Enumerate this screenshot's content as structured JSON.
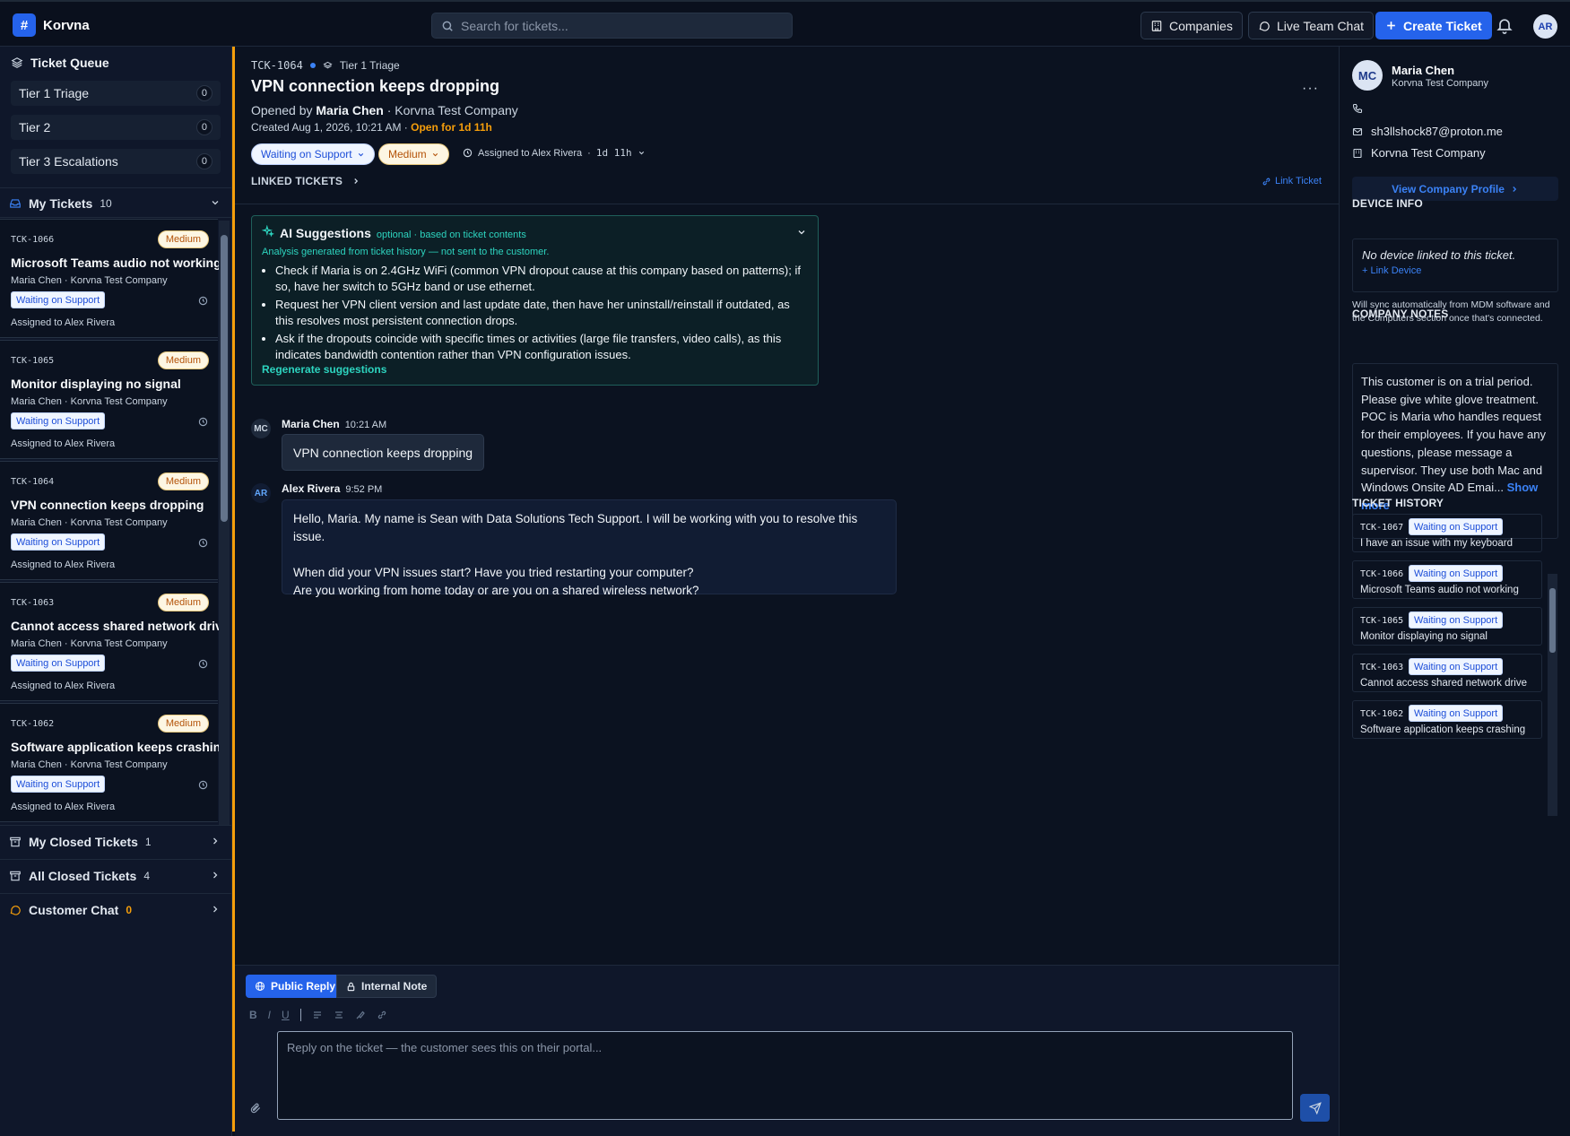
{
  "app": {
    "name": "Korvna",
    "logo_glyph": "#"
  },
  "search": {
    "placeholder": "Search for tickets..."
  },
  "topbar": {
    "companies": "Companies",
    "live_chat": "Live Team Chat",
    "create": "Create Ticket",
    "user_initials": "AR"
  },
  "sidebar": {
    "queue_title": "Ticket Queue",
    "queues": [
      {
        "label": "Tier 1 Triage",
        "count": "0"
      },
      {
        "label": "Tier 2",
        "count": "0"
      },
      {
        "label": "Tier 3 Escalations",
        "count": "0"
      }
    ],
    "my_tickets": {
      "label": "My Tickets",
      "count": "10"
    },
    "tickets": [
      {
        "id": "TCK-1066",
        "priority": "Medium",
        "title": "Microsoft Teams audio not working",
        "sub": "Maria Chen · Korvna Test Company",
        "status": "Waiting on Support",
        "assigned": "Assigned to Alex Rivera"
      },
      {
        "id": "TCK-1065",
        "priority": "Medium",
        "title": "Monitor displaying no signal",
        "sub": "Maria Chen · Korvna Test Company",
        "status": "Waiting on Support",
        "assigned": "Assigned to Alex Rivera"
      },
      {
        "id": "TCK-1064",
        "priority": "Medium",
        "title": "VPN connection keeps dropping",
        "sub": "Maria Chen · Korvna Test Company",
        "status": "Waiting on Support",
        "assigned": "Assigned to Alex Rivera"
      },
      {
        "id": "TCK-1063",
        "priority": "Medium",
        "title": "Cannot access shared network drive",
        "sub": "Maria Chen · Korvna Test Company",
        "status": "Waiting on Support",
        "assigned": "Assigned to Alex Rivera"
      },
      {
        "id": "TCK-1062",
        "priority": "Medium",
        "title": "Software application keeps crashing",
        "sub": "Maria Chen · Korvna Test Company",
        "status": "Waiting on Support",
        "assigned": "Assigned to Alex Rivera"
      }
    ],
    "my_closed": {
      "label": "My Closed Tickets",
      "count": "1"
    },
    "all_closed": {
      "label": "All Closed Tickets",
      "count": "4"
    },
    "customer_chat": {
      "label": "Customer Chat",
      "count": "0"
    }
  },
  "ticket": {
    "id": "TCK-1064",
    "queue": "Tier 1 Triage",
    "title": "VPN connection keeps dropping",
    "opened_prefix": "Opened by",
    "opened_by": "Maria Chen",
    "opened_suffix": "· Korvna Test Company",
    "created": "Created Aug 1, 2026, 10:21 AM ·",
    "open_for": "Open for 1d 11h",
    "status": "Waiting on Support",
    "priority": "Medium",
    "assigned": "Assigned to Alex Rivera",
    "sep": "·",
    "age": "1d 11h",
    "more": "···",
    "linked_label": "LINKED TICKETS",
    "link_action": "Link Ticket"
  },
  "ai": {
    "title": "AI Suggestions",
    "subtitle": "optional · based on ticket contents",
    "note": "Analysis generated from ticket history — not sent to the customer.",
    "suggestions": [
      "Check if Maria is on 2.4GHz WiFi (common VPN dropout cause at this company based on patterns); if so, have her switch to 5GHz band or use ethernet.",
      "Request her VPN client version and last update date, then have her uninstall/reinstall if outdated, as this resolves most persistent connection drops.",
      "Ask if the dropouts coincide with specific times or activities (large file transfers, video calls), as this indicates bandwidth contention rather than VPN configuration issues."
    ],
    "regenerate": "Regenerate suggestions"
  },
  "messages": [
    {
      "initials": "MC",
      "author": "Maria Chen",
      "time": "10:21 AM",
      "body": "VPN connection keeps dropping"
    },
    {
      "initials": "AR",
      "author": "Alex Rivera",
      "time": "9:52 PM",
      "lines": [
        "Hello, Maria. My name is Sean with Data Solutions Tech Support. I will be working with you to resolve this issue.",
        "When did your VPN issues start? Have you tried restarting your computer?",
        "Are you working from home today or are you on a shared wireless network?"
      ]
    }
  ],
  "composer": {
    "public_reply": "Public Reply",
    "internal_note": "Internal Note",
    "toolbar": [
      "B",
      "I",
      "U"
    ],
    "placeholder": "Reply on the ticket — the customer sees this on their portal..."
  },
  "contact": {
    "initials": "MC",
    "name": "Maria Chen",
    "company": "Korvna Test Company",
    "phone": "",
    "email": "sh3llshock87@proton.me",
    "company_line": "Korvna Test Company",
    "view_profile": "View Company Profile"
  },
  "device": {
    "title": "DEVICE INFO",
    "none": "No device linked to this ticket.",
    "link": "+ Link Device",
    "sync_note": "Will sync automatically from MDM software and the Computers section once that's connected."
  },
  "notes": {
    "title": "COMPANY NOTES",
    "text": "This customer is on a trial period. Please give white glove treatment. POC is Maria who handles request for their employees. If you have any questions, please message a supervisor. They use both Mac and Windows Onsite AD Emai...",
    "more": "Show more"
  },
  "history": {
    "title": "TICKET HISTORY",
    "items": [
      {
        "id": "TCK-1067",
        "status": "Waiting on Support",
        "title": "I have an issue with my keyboard"
      },
      {
        "id": "TCK-1066",
        "status": "Waiting on Support",
        "title": "Microsoft Teams audio not working"
      },
      {
        "id": "TCK-1065",
        "status": "Waiting on Support",
        "title": "Monitor displaying no signal"
      },
      {
        "id": "TCK-1063",
        "status": "Waiting on Support",
        "title": "Cannot access shared network drive"
      },
      {
        "id": "TCK-1062",
        "status": "Waiting on Support",
        "title": "Software application keeps crashing"
      }
    ]
  },
  "colors": {
    "accent": "#2563eb",
    "warning": "#f59e0b",
    "teal": "#2dd4bf",
    "bg": "#0b1220"
  }
}
